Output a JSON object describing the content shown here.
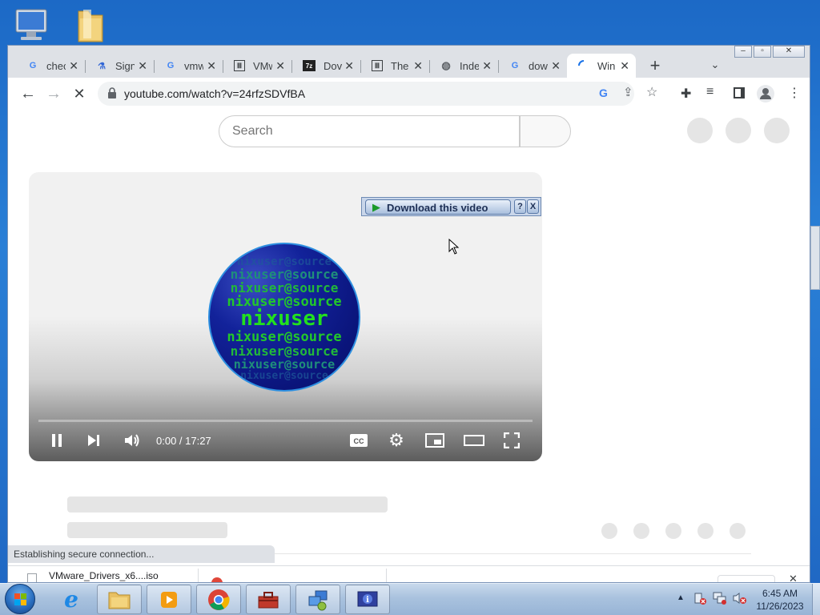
{
  "browser": {
    "tabs": [
      {
        "label": "chec",
        "icon": "google-icon"
      },
      {
        "label": "Sign",
        "icon": "flask-icon"
      },
      {
        "label": "vmw",
        "icon": "google-icon"
      },
      {
        "label": "VMw",
        "icon": "museum-icon"
      },
      {
        "label": "Dov",
        "icon": "7zip-icon"
      },
      {
        "label": "The",
        "icon": "museum-icon"
      },
      {
        "label": "Inde",
        "icon": "globe-icon"
      },
      {
        "label": "dow",
        "icon": "google-icon"
      },
      {
        "label": "Win",
        "icon": "loading-icon",
        "active": true
      }
    ],
    "new_tab": "+",
    "url": "youtube.com/watch?v=24rfzSDVfBA",
    "status": "Establishing secure connection..."
  },
  "youtube": {
    "search_placeholder": "Search",
    "download_label": "Download this video",
    "help_label": "?",
    "close_label": "X",
    "time": "0:00 / 17:27",
    "logo": {
      "main": "nixuser",
      "repeat": "nixuser@source"
    }
  },
  "downloads": {
    "file": "VMware_Drivers_x6....iso"
  },
  "taskbar": {
    "time": "6:45 AM",
    "date": "11/26/2023"
  },
  "colors": {
    "accent": "#1a73e8",
    "desktop": "#1f6dc9",
    "logo_green": "#22e01e",
    "logo_blue": "#0d1a8a"
  }
}
